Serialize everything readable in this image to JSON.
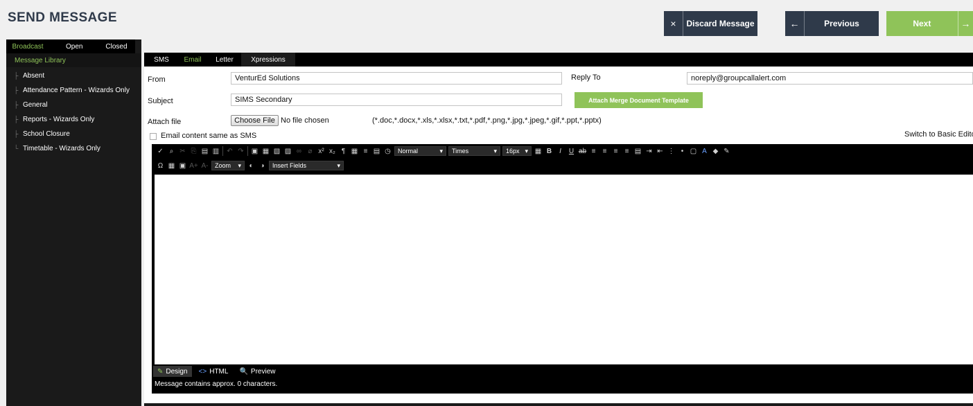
{
  "page_title": "SEND MESSAGE",
  "actions": {
    "discard_icon": "×",
    "discard_label": "Discard Message",
    "previous_icon": "←",
    "previous_label": "Previous",
    "next_label": "Next",
    "next_icon": "→"
  },
  "sidebar": {
    "tabs": [
      "Broadcast",
      "Open",
      "Closed"
    ],
    "active_tab": "Broadcast",
    "library_title": "Message Library",
    "items": [
      "Absent",
      "Attendance Pattern - Wizards Only",
      "General",
      "Reports - Wizards Only",
      "School Closure",
      "Timetable - Wizards Only"
    ]
  },
  "main_tabs": [
    "SMS",
    "Email",
    "Letter",
    "Xpressions"
  ],
  "active_main_tab": "Email",
  "form": {
    "from_label": "From",
    "from_value": "VenturEd Solutions",
    "reply_to_label": "Reply To",
    "reply_to_value": "noreply@groupcallalert.com",
    "subject_label": "Subject",
    "subject_value": "SIMS Secondary",
    "merge_button": "Attach Merge Document Template",
    "attach_label": "Attach file",
    "choose_file": "Choose File",
    "no_file": "No file chosen",
    "allowed_types": "(*.doc,*.docx,*.xls,*.xlsx,*.txt,*.pdf,*.png,*.jpg,*.jpeg,*.gif,*.ppt,*.pptx)",
    "same_as_sms_label": "Email content same as SMS",
    "switch_editor": "Switch to Basic Edito"
  },
  "editor": {
    "format_value": "Normal",
    "font_value": "Times",
    "size_value": "16px",
    "zoom_label": "Zoom",
    "insert_fields": "Insert Fields",
    "modes": [
      "Design",
      "HTML",
      "Preview"
    ],
    "mode_icons": [
      "✎",
      "<>",
      "🔍"
    ],
    "active_mode": "Design",
    "char_count": "Message contains approx. 0 characters."
  },
  "colors": {
    "accent": "#8fc359",
    "dark_button": "#2f3a4a",
    "sidebar_bg": "#1a1a1a"
  }
}
